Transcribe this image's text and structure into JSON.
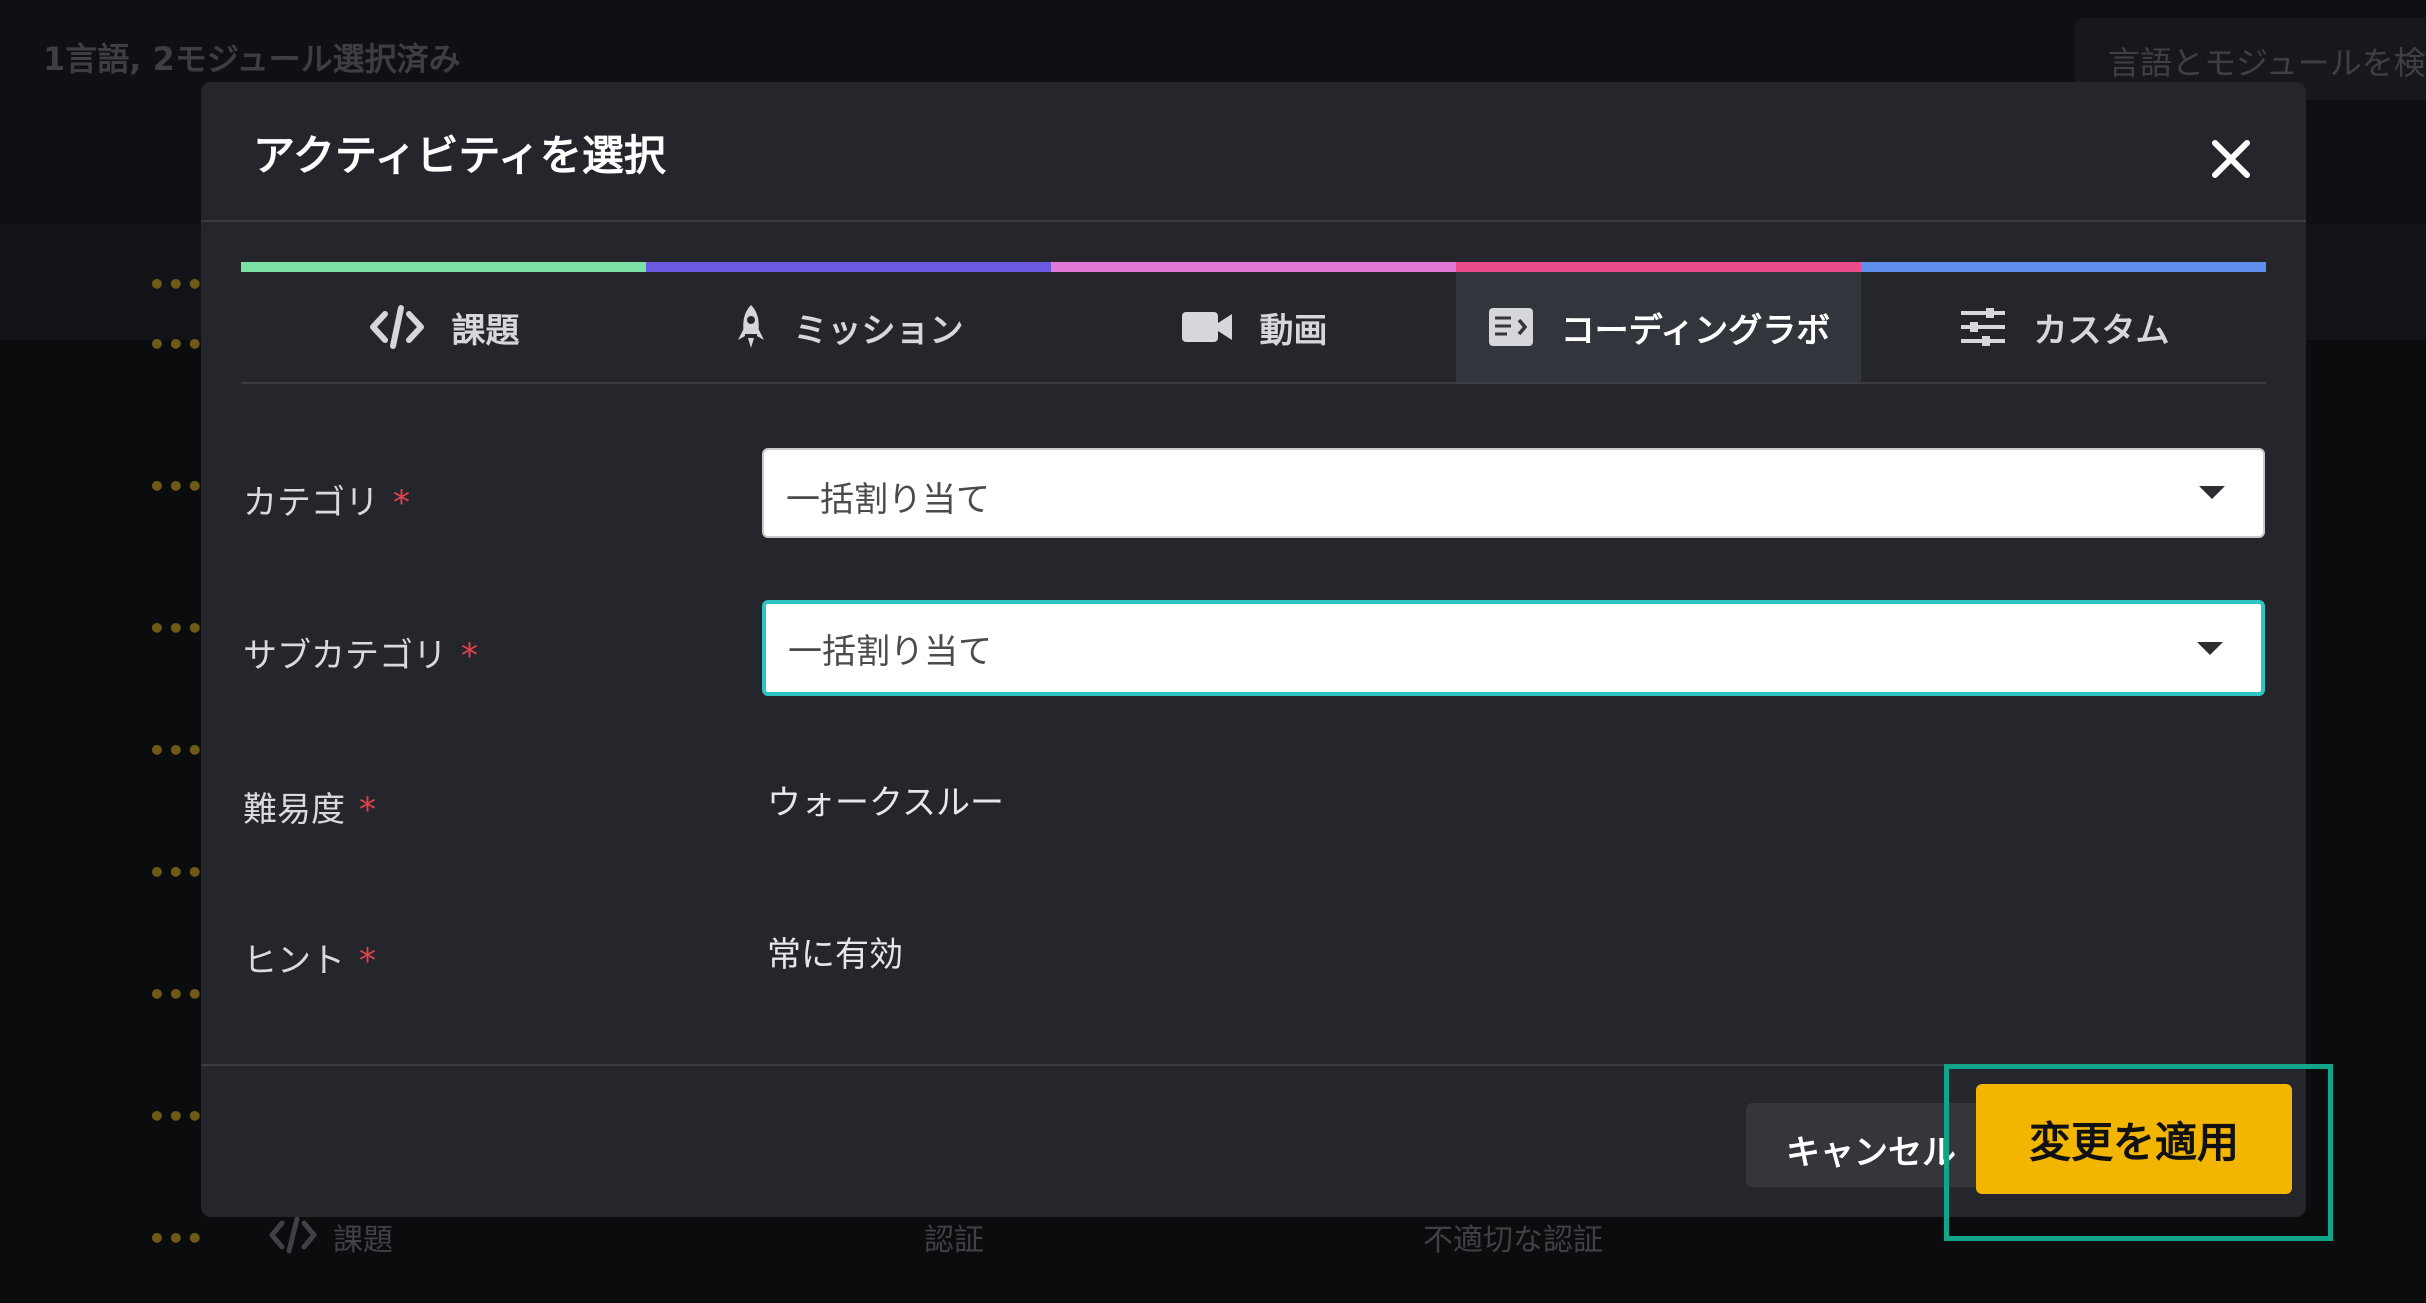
{
  "background": {
    "summary": "1言語, 2モジュール選択済み",
    "search_placeholder": "言語とモジュールを検索",
    "row_dots": "•••",
    "bottom_row": {
      "type": "課題",
      "category": "認証",
      "subcategory": "不適切な認証"
    }
  },
  "modal": {
    "title": "アクティビティを選択",
    "tabs": [
      {
        "label": "課題",
        "icon": "code-icon",
        "color": "#7be2a4"
      },
      {
        "label": "ミッション",
        "icon": "rocket-icon",
        "color": "#6a5ae0"
      },
      {
        "label": "動画",
        "icon": "video-camera-icon",
        "color": "#e279d8"
      },
      {
        "label": "コーディングラボ",
        "icon": "coding-lab-icon",
        "color": "#ec4c8c",
        "active": true
      },
      {
        "label": "カスタム",
        "icon": "sliders-icon",
        "color": "#5e8fee"
      }
    ],
    "form": {
      "category": {
        "label": "カテゴリ",
        "required_mark": "*",
        "value": "一括割り当て"
      },
      "subcategory": {
        "label": "サブカテゴリ",
        "required_mark": "*",
        "value": "一括割り当て"
      },
      "difficulty": {
        "label": "難易度",
        "required_mark": "*",
        "value": "ウォークスルー"
      },
      "hint": {
        "label": "ヒント",
        "required_mark": "*",
        "value": "常に有効"
      }
    },
    "footer": {
      "cancel_label": "キャンセル",
      "apply_label": "変更を適用"
    }
  },
  "colors": {
    "accent": "#f2b600",
    "focus": "#2ec4c2",
    "highlight": "#12a58a",
    "required": "#e0434b"
  }
}
